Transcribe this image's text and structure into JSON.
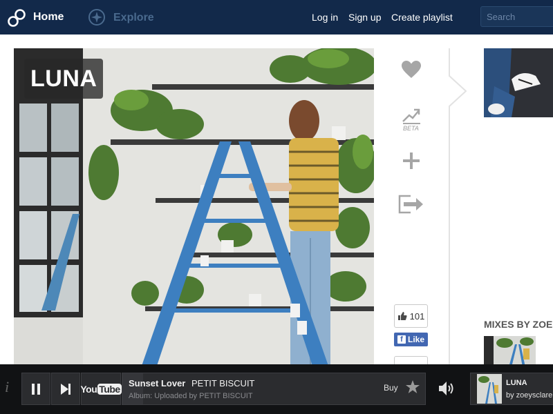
{
  "nav": {
    "home_label": "Home",
    "explore_label": "Explore",
    "links": [
      "Log in",
      "Sign up",
      "Create playlist"
    ],
    "search_placeholder": "Search"
  },
  "mix": {
    "title": "LUNA"
  },
  "actions": {
    "like_icon": "heart-icon",
    "trend_icon": "trending-icon",
    "beta_label": "BETA",
    "add_icon": "plus-icon",
    "share_icon": "share-icon"
  },
  "facebook": {
    "like_count": "101",
    "like_label": "Like"
  },
  "sidebar": {
    "mixes_heading": "MIXES BY ZOE"
  },
  "player": {
    "info_glyph": "i",
    "track_title": "Sunset Lover",
    "track_artist": "PETIT BISCUIT",
    "album_line": "Album: Uploaded by PETIT BISCUIT",
    "buy_label": "Buy",
    "youtube_label_you": "You",
    "youtube_label_tube": "Tube",
    "now_playing_title": "LUNA",
    "now_playing_user": "by zoeysclare"
  },
  "colors": {
    "nav_bg": "#12294a",
    "player_bg": "#111214",
    "facebook_blue": "#4267b2",
    "action_gray": "#a6a6a6"
  }
}
